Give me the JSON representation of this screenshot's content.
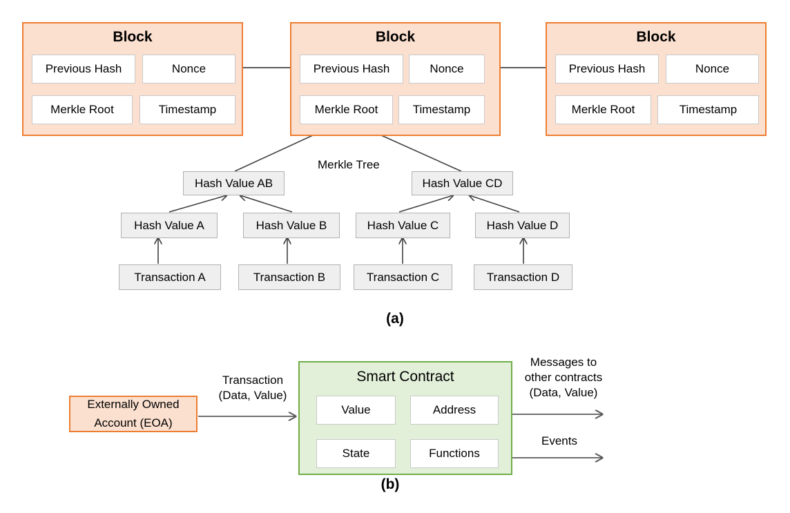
{
  "figure": {
    "panel_a_caption": "(a)",
    "panel_b_caption": "(b)"
  },
  "panel_a": {
    "merkle_tree_label": "Merkle Tree",
    "blocks": [
      {
        "title": "Block",
        "fields": [
          "Previous Hash",
          "Nonce",
          "Merkle Root",
          "Timestamp"
        ]
      },
      {
        "title": "Block",
        "fields": [
          "Previous Hash",
          "Nonce",
          "Merkle Root",
          "Timestamp"
        ]
      },
      {
        "title": "Block",
        "fields": [
          "Previous Hash",
          "Nonce",
          "Merkle Root",
          "Timestamp"
        ]
      }
    ],
    "merkle_tree": {
      "intermediate_hashes": [
        "Hash Value AB",
        "Hash Value CD"
      ],
      "leaf_hashes": [
        "Hash Value A",
        "Hash Value B",
        "Hash Value C",
        "Hash Value D"
      ],
      "transactions": [
        "Transaction A",
        "Transaction B",
        "Transaction C",
        "Transaction D"
      ]
    }
  },
  "panel_b": {
    "eoa": {
      "line1": "Externally Owned",
      "line2": "Account (EOA)"
    },
    "transaction_label": {
      "line1": "Transaction",
      "line2": "(Data, Value)"
    },
    "contract": {
      "title": "Smart Contract",
      "fields": [
        "Value",
        "Address",
        "State",
        "Functions"
      ]
    },
    "messages_label": {
      "line1": "Messages to",
      "line2": "other contracts",
      "line3": "(Data, Value)"
    },
    "events_label": "Events"
  },
  "colors": {
    "block_fill": "#fbe0cf",
    "block_border": "#ed7d31",
    "contract_fill": "#e2efd9",
    "contract_border": "#70ad47",
    "node_fill": "#efefef",
    "node_border": "#b0b0b0",
    "arrow": "#595959",
    "tree_arrow": "#404040"
  }
}
